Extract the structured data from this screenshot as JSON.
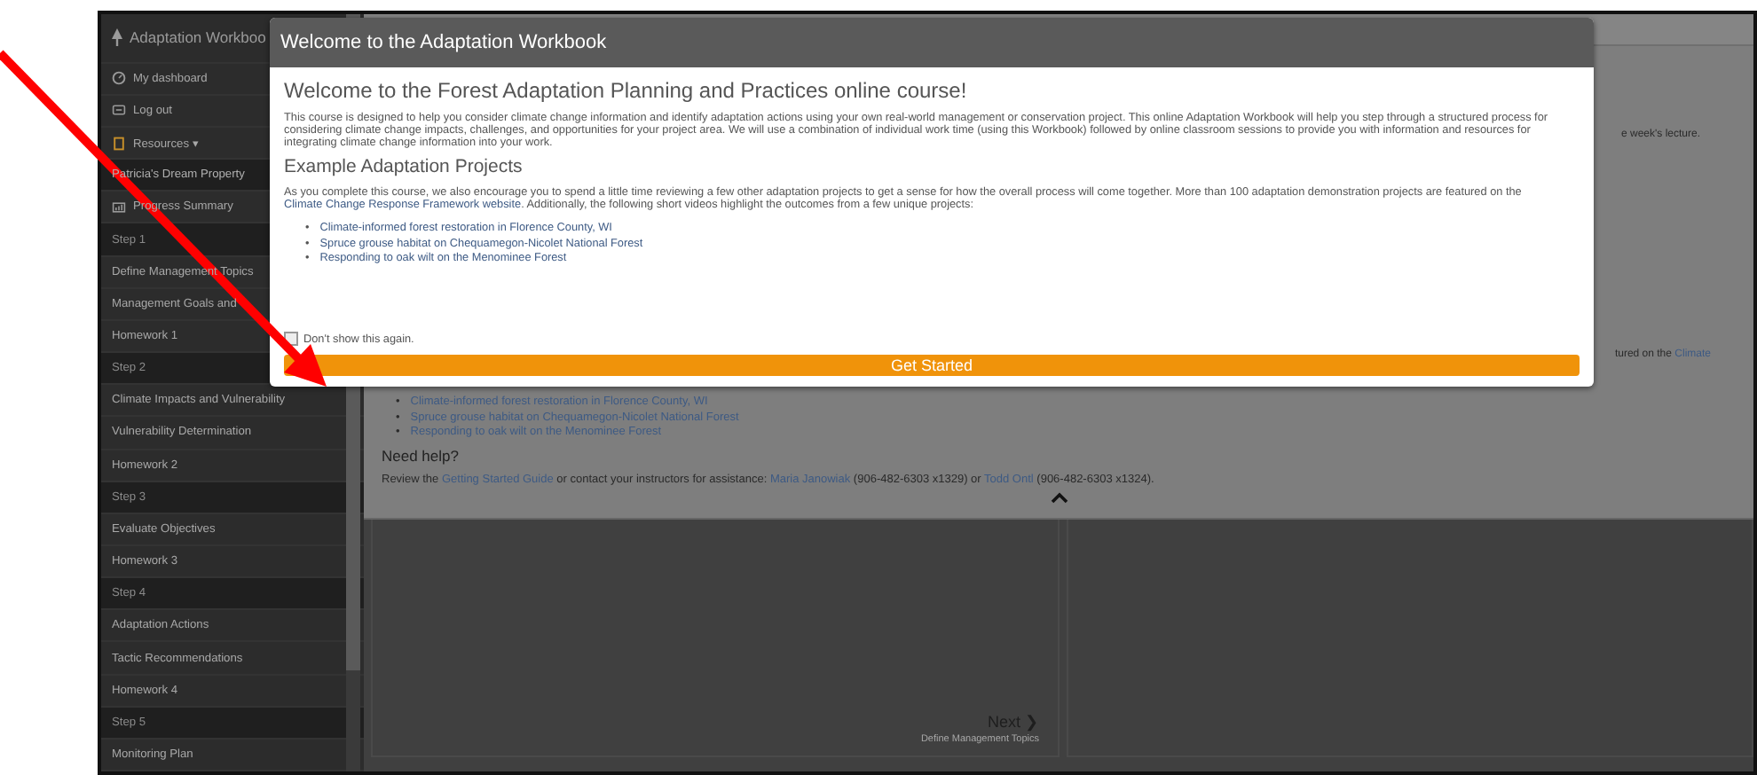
{
  "sidebar": {
    "title": "Adaptation Workboo",
    "items": [
      {
        "kind": "dashboard",
        "label": "My dashboard",
        "selected": false
      },
      {
        "kind": "logout",
        "label": "Log out",
        "selected": false
      },
      {
        "kind": "resources",
        "label": "Resources",
        "caret": "▾",
        "selected": false
      },
      {
        "kind": "project",
        "label": "Patricia's Dream Property",
        "selected": true
      },
      {
        "kind": "summary",
        "label": "Progress Summary",
        "selected": false
      },
      {
        "kind": "step",
        "label": "Step 1",
        "selected": false
      },
      {
        "kind": "page",
        "label": "Define Management Topics",
        "selected": false
      },
      {
        "kind": "page",
        "label": "Management Goals and",
        "selected": false
      },
      {
        "kind": "page",
        "label": "Homework 1",
        "selected": false
      },
      {
        "kind": "step",
        "label": "Step 2",
        "selected": false
      },
      {
        "kind": "page",
        "label": "Climate Impacts and Vulnerability",
        "selected": false
      },
      {
        "kind": "page",
        "label": "Vulnerability Determination",
        "selected": false
      },
      {
        "kind": "page",
        "label": "Homework 2",
        "selected": false
      },
      {
        "kind": "step",
        "label": "Step 3",
        "selected": false
      },
      {
        "kind": "page",
        "label": "Evaluate Objectives",
        "selected": false
      },
      {
        "kind": "page",
        "label": "Homework 3",
        "selected": false
      },
      {
        "kind": "step",
        "label": "Step 4",
        "selected": false
      },
      {
        "kind": "page",
        "label": "Adaptation Actions",
        "selected": false
      },
      {
        "kind": "page",
        "label": "Tactic Recommendations",
        "selected": false
      },
      {
        "kind": "page",
        "label": "Homework 4",
        "selected": false
      },
      {
        "kind": "step",
        "label": "Step 5",
        "selected": false
      },
      {
        "kind": "page",
        "label": "Monitoring Plan",
        "selected": false
      }
    ]
  },
  "background": {
    "lecture_fragment": "e week's lecture.",
    "framework_fragment": [
      {
        "kind": "text",
        "text": "tured on the "
      },
      {
        "kind": "link",
        "text": "Climate"
      }
    ],
    "video_links": [
      {
        "bullet": "•",
        "text": "Climate-informed forest restoration in Florence County, WI"
      },
      {
        "bullet": "•",
        "text": "Spruce grouse habitat on Chequamegon-Nicolet National Forest"
      },
      {
        "bullet": "•",
        "text": "Responding to oak wilt on the Menominee Forest"
      }
    ],
    "help_heading": "Need help?",
    "help_text": [
      {
        "kind": "text",
        "text": "Review the "
      },
      {
        "kind": "link",
        "text": "Getting Started Guide"
      },
      {
        "kind": "text",
        "text": " or contact your instructors for assistance: "
      },
      {
        "kind": "link",
        "text": "Maria Janowiak"
      },
      {
        "kind": "text",
        "text": " (906-482-6303 x1329) or "
      },
      {
        "kind": "link",
        "text": "Todd Ontl"
      },
      {
        "kind": "text",
        "text": " (906-482-6303 x1324)."
      }
    ],
    "next": {
      "label": "Next",
      "caret": "❯",
      "subtitle": "Define Management Topics"
    }
  },
  "modal": {
    "title": "Welcome to the Adaptation Workbook",
    "heading": "Welcome to the Forest Adaptation Planning and Practices online course!",
    "intro": "This course is designed to help you consider climate change information and identify adaptation actions using your own real-world management or conservation project. This online Adaptation Workbook will help you step through a structured process for considering climate change impacts, challenges, and opportunities for your project area. We will use a combination of individual work time (using this Workbook) followed by online classroom sessions to provide you with information and resources for integrating climate change information into your work.",
    "examples_heading": "Example Adaptation Projects",
    "examples_text": [
      {
        "kind": "text",
        "text": "As you complete this course, we also encourage you to spend a little time reviewing a few other adaptation projects to get a sense for how the overall process will come together. More than 100 adaptation demonstration projects are featured on the "
      },
      {
        "kind": "link",
        "text": "Climate Change Response Framework website"
      },
      {
        "kind": "text",
        "text": ". Additionally, the following short videos highlight the outcomes from a few unique projects:"
      }
    ],
    "video_links": [
      {
        "bullet": "•",
        "text": "Climate-informed forest restoration in Florence County, WI"
      },
      {
        "bullet": "•",
        "text": "Spruce grouse habitat on Chequamegon-Nicolet National Forest"
      },
      {
        "bullet": "•",
        "text": "Responding to oak wilt on the Menominee Forest"
      }
    ],
    "dont_show": {
      "label": "Don't show this again.",
      "checked": false
    },
    "button": "Get Started"
  }
}
